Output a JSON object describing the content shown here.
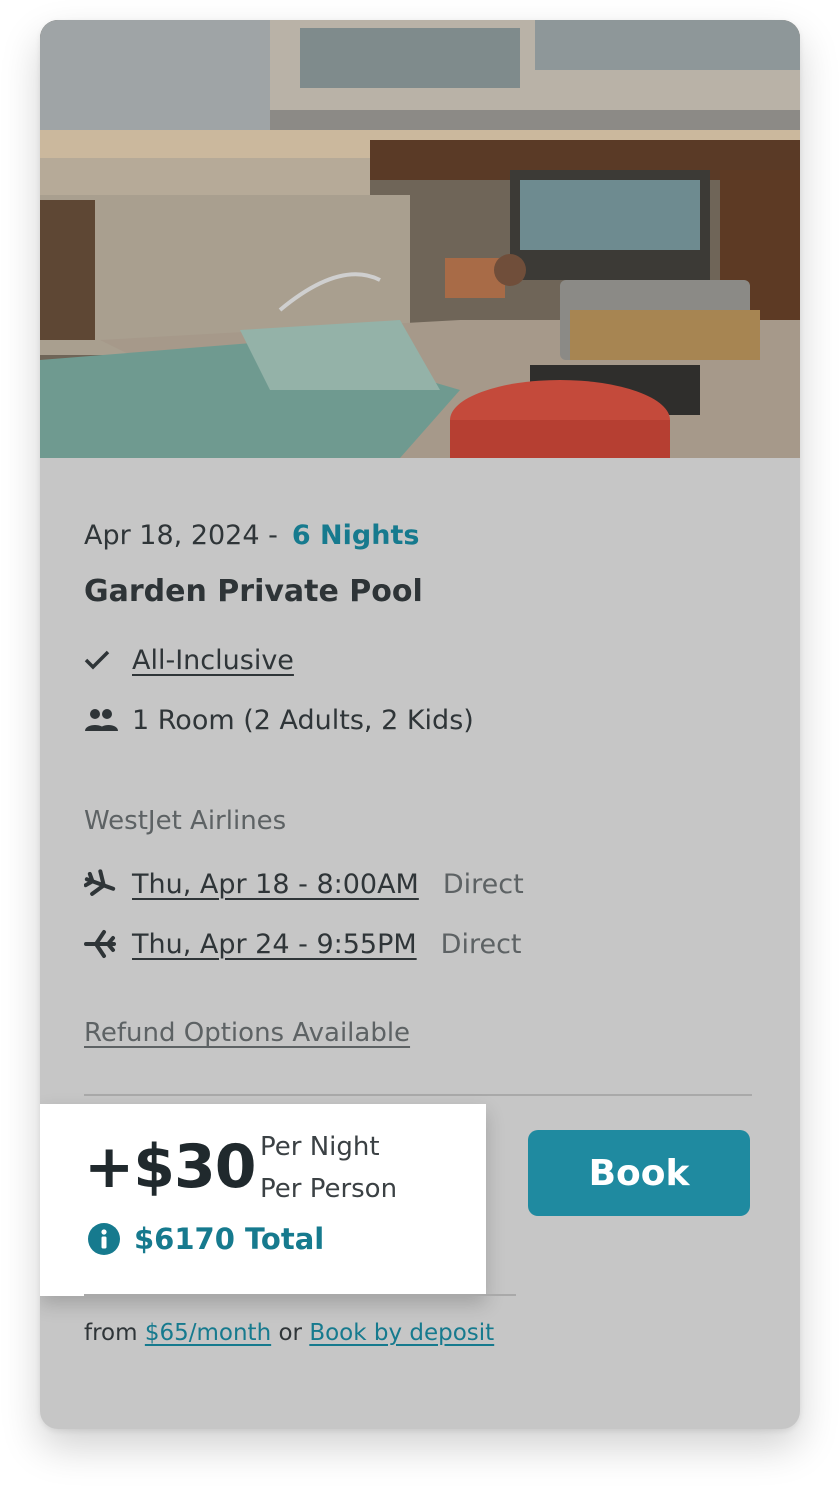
{
  "offer": {
    "date": "Apr 18, 2024 -",
    "nights": "6 Nights",
    "room_name": "Garden Private Pool",
    "plan": "All-Inclusive",
    "occupancy": "1 Room (2 Adults, 2 Kids)",
    "airline": "WestJet Airlines",
    "flights": [
      {
        "time": "Thu, Apr 18 - 8:00AM",
        "type": "Direct",
        "icon": "plane-departure-icon"
      },
      {
        "time": "Thu, Apr 24 - 9:55PM",
        "type": "Direct",
        "icon": "plane-return-icon"
      }
    ],
    "refund_link": "Refund Options Available"
  },
  "pricing": {
    "price": "+$30",
    "per_night": "Per Night",
    "per_person": "Per Person",
    "total": "$6170 Total",
    "book_label": "Book",
    "finance_from": "from",
    "monthly": "$65/month",
    "or": "or",
    "deposit": "Book by deposit"
  },
  "colors": {
    "accent": "#167a8e",
    "button": "#1f8aa0",
    "card_bg": "#c6c6c6"
  },
  "icons": [
    "check-icon",
    "people-icon",
    "plane-departure-icon",
    "plane-return-icon",
    "info-icon"
  ]
}
